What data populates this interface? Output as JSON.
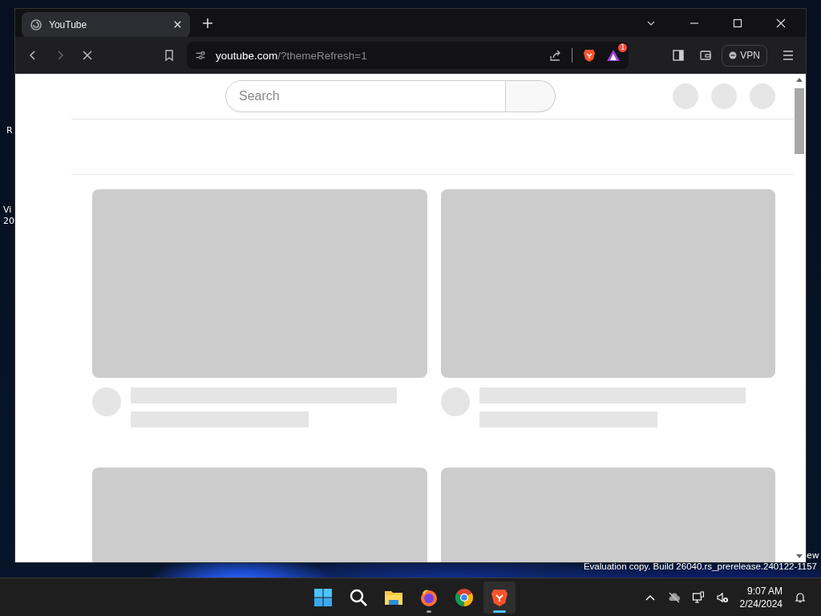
{
  "desktop": {
    "icon_labels": [
      {
        "text": "R"
      },
      {
        "text": "Vi\n20"
      }
    ],
    "corner_label": "ew",
    "watermark": "Evaluation copy. Build 26040.rs_prerelease.240122-1157"
  },
  "browser": {
    "tabs": [
      {
        "title": "YouTube",
        "selected": true
      }
    ],
    "address": {
      "host": "youtube.com",
      "path": "/?themeRefresh=1"
    },
    "loading": true,
    "rewards_badge": "1",
    "vpn_label": "VPN"
  },
  "page": {
    "search": {
      "placeholder": "Search"
    },
    "video_placeholders": [
      {
        "kind": "full"
      },
      {
        "kind": "full"
      },
      {
        "kind": "thumbnail"
      },
      {
        "kind": "thumbnail"
      }
    ]
  },
  "taskbar": {
    "apps": [
      {
        "kind": "start",
        "running": false,
        "selected": false
      },
      {
        "kind": "search",
        "running": false,
        "selected": false
      },
      {
        "kind": "files",
        "running": false,
        "selected": false
      },
      {
        "kind": "firefox",
        "running": true,
        "selected": false
      },
      {
        "kind": "chrome",
        "running": false,
        "selected": false
      },
      {
        "kind": "brave",
        "running": true,
        "selected": true
      }
    ],
    "time": "9:07 AM",
    "date": "2/24/2024"
  }
}
